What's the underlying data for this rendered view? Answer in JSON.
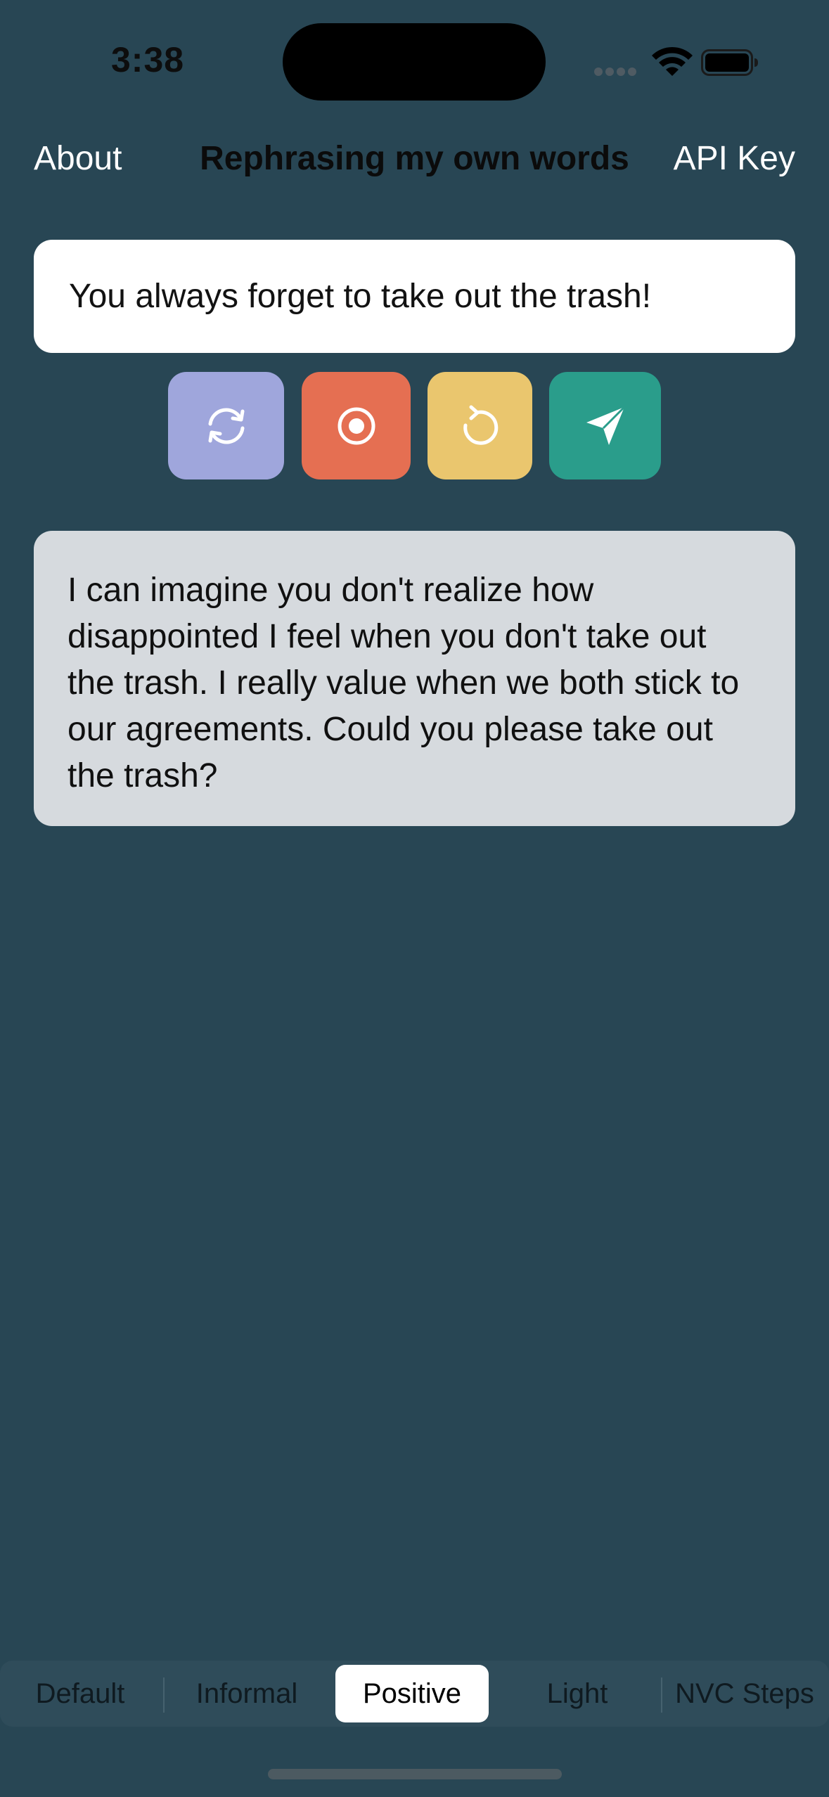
{
  "status_bar": {
    "time": "3:38"
  },
  "nav": {
    "left_label": "About",
    "title": "Rephrasing my own words",
    "right_label": "API Key"
  },
  "input": {
    "text": "You always forget to take out the trash!"
  },
  "actions": {
    "refresh_icon": "arrow-cycle-icon",
    "record_icon": "record-icon",
    "undo_icon": "counterclockwise-arrow-icon",
    "send_icon": "paper-plane-icon",
    "colors": {
      "refresh": "#9fa6dc",
      "record": "#e56f52",
      "undo": "#eac66e",
      "send": "#2a9d8b"
    }
  },
  "output": {
    "text": "I can imagine you don't realize how disappointed I feel when you don't take out the trash. I really value when we both stick to our agreements. Could you please take out the trash?"
  },
  "segments": {
    "items": [
      "Default",
      "Informal",
      "Positive",
      "Light",
      "NVC Steps"
    ],
    "selected": "Positive"
  },
  "theme": {
    "background": "#284654"
  }
}
